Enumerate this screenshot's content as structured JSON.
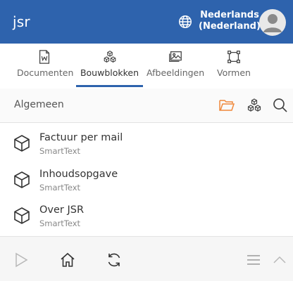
{
  "header": {
    "app_title": "jsr",
    "language_line1": "Nederlands",
    "language_line2": "(Nederland)",
    "icons": {
      "language": "globe-icon",
      "user": "user-avatar-icon"
    },
    "color": "#2e63ad"
  },
  "tabs": [
    {
      "label": "Documenten",
      "icon": "document-word-icon",
      "active": false
    },
    {
      "label": "Bouwblokken",
      "icon": "cubes-icon",
      "active": true
    },
    {
      "label": "Afbeeldingen",
      "icon": "image-icon",
      "active": false
    },
    {
      "label": "Vormen",
      "icon": "shapes-icon",
      "active": false
    }
  ],
  "toolbar": {
    "breadcrumb": "Algemeen",
    "icons": [
      "folder-icon",
      "cubes-icon",
      "search-icon"
    ],
    "accent_color": "#f0883a"
  },
  "items": [
    {
      "name": "Factuur per mail",
      "type": "SmartText",
      "icon": "cube-icon"
    },
    {
      "name": "Inhoudsopgave",
      "type": "SmartText",
      "icon": "cube-icon"
    },
    {
      "name": "Over JSR",
      "type": "SmartText",
      "icon": "cube-icon"
    }
  ],
  "bottom_bar": {
    "icons": [
      "play-icon",
      "home-icon",
      "refresh-icon",
      "menu-icon",
      "chevron-up-icon"
    ]
  }
}
